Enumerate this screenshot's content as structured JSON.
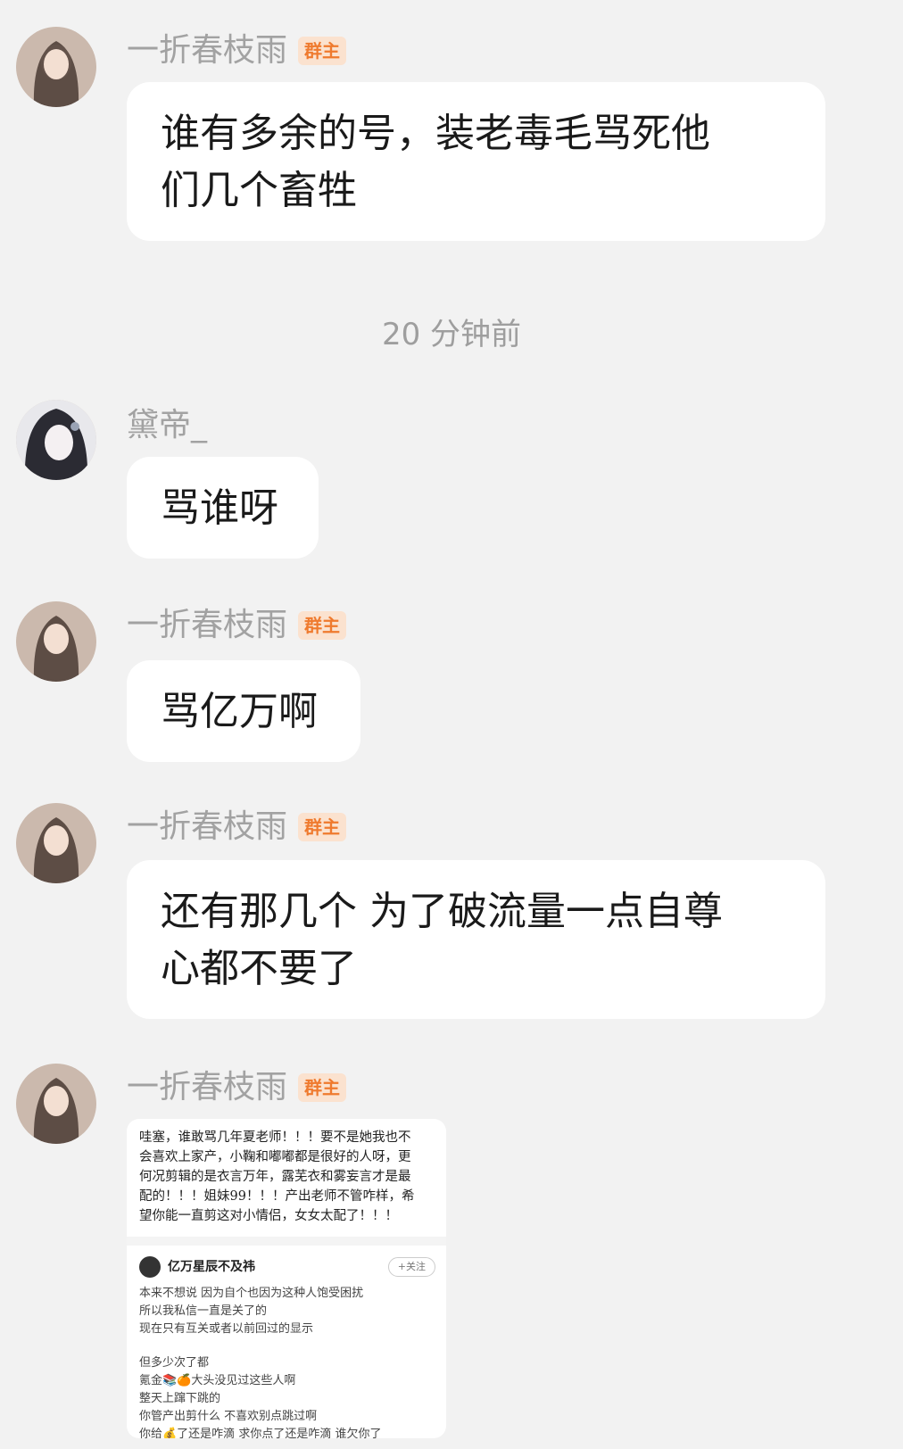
{
  "owner_badge": "群主",
  "time_divider": "20 分钟前",
  "messages": [
    {
      "sender": "一折春枝雨",
      "text_line1": "谁有多余的号，装老毒毛骂死他",
      "text_line2": "们几个畜牲"
    },
    {
      "sender": "黛帝_",
      "text": "骂谁呀"
    },
    {
      "sender": "一折春枝雨",
      "text": "骂亿万啊"
    },
    {
      "sender": "一折春枝雨",
      "text_line1": "还有那几个 为了破流量一点自尊",
      "text_line2": "心都不要了"
    },
    {
      "sender": "一折春枝雨"
    }
  ],
  "image_card": {
    "comment_lines": [
      "哇塞，谁敢骂几年夏老师！！！要不是她我也不",
      "会喜欢上家产，小鞠和嘟嘟都是很好的人呀，更",
      "何况剪辑的是衣言万年，露芜衣和雾妄言才是最",
      "配的！！！姐妹99！！！产出老师不管咋样，希",
      "望你能一直剪这对小情侣，女女太配了！！！"
    ],
    "post_user": "亿万星辰不及祎",
    "follow_label": "+关注",
    "post_lines_a": [
      "本来不想说 因为自个也因为这种人饱受困扰",
      "所以我私信一直是关了的",
      "现在只有互关或者以前回过的显示"
    ],
    "post_lines_b": [
      "但多少次了都",
      "氪金📚🍊大头没见过这些人啊",
      "整天上蹿下跳的",
      "你管产出剪什么 不喜欢别点跳过啊",
      "你给💰了还是咋滴 求你点了还是咋滴 谁欠你了"
    ]
  }
}
